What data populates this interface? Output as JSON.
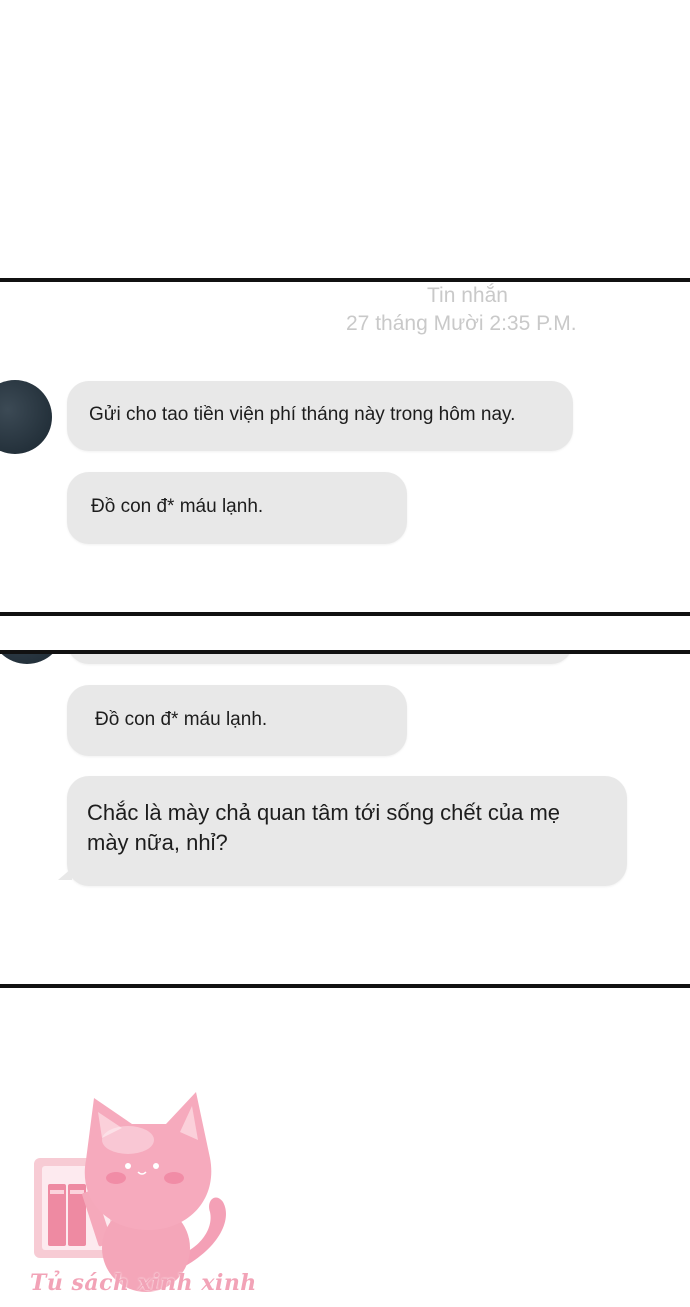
{
  "panel1": {
    "header_title": "Tin nhắn",
    "header_timestamp": "27 tháng Mười 2:35 P.M.",
    "messages": [
      {
        "text": "Gửi cho tao tiền viện phí tháng này trong hôm nay."
      },
      {
        "text": "Đồ con đ* máu lạnh."
      }
    ]
  },
  "panel2": {
    "messages": [
      {
        "text": "Đồ con đ* máu lạnh."
      },
      {
        "text_line1": "Chắc là mày chả quan tâm tới sống chết của mẹ",
        "text_line2": "mày nữa, nhỉ?"
      }
    ]
  },
  "watermark": {
    "text": "Tủ sách xinh xinh"
  },
  "colors": {
    "bubble": "#e8e8e8",
    "border": "#111111",
    "header_text": "#c9c9c9",
    "watermark": "#f2a3b7"
  }
}
